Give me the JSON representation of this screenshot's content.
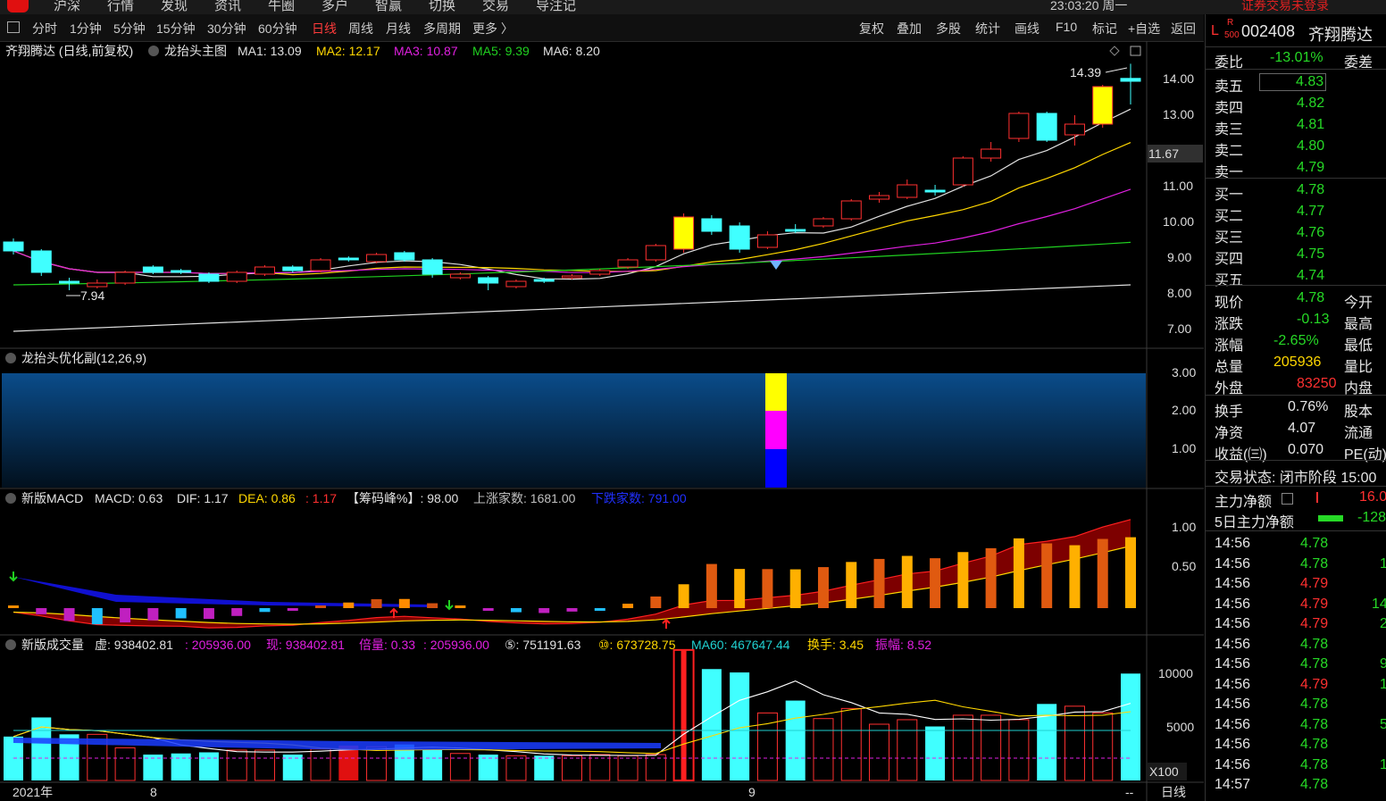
{
  "topbar": {
    "nav": [
      "沪深",
      "行情",
      "发现",
      "资讯",
      "牛圈",
      "多户",
      "智赢",
      "切换",
      "交易",
      "导注记"
    ],
    "clock": "23:03:20 周一",
    "login": "证券交易未登录"
  },
  "toolbar": {
    "periods": [
      {
        "label": "分时"
      },
      {
        "label": "1分钟"
      },
      {
        "label": "5分钟"
      },
      {
        "label": "15分钟"
      },
      {
        "label": "30分钟"
      },
      {
        "label": "60分钟"
      },
      {
        "label": "日线",
        "active": true
      },
      {
        "label": "周线"
      },
      {
        "label": "月线"
      },
      {
        "label": "多周期"
      },
      {
        "label": "更多 〉"
      }
    ],
    "tools": [
      "复权",
      "叠加",
      "多股",
      "统计",
      "画线",
      "F10",
      "标记",
      "+自选",
      "返回"
    ]
  },
  "main_panel": {
    "title": "齐翔腾达 (日线,前复权)",
    "indicator": "龙抬头主图",
    "ma": [
      {
        "label": "MA1: 13.09",
        "color": "#e0e0e0"
      },
      {
        "label": "MA2: 12.17",
        "color": "#ffd700"
      },
      {
        "label": "MA3: 10.87",
        "color": "#e020e0"
      },
      {
        "label": "MA5: 9.39",
        "color": "#20d020"
      },
      {
        "label": "MA6: 8.20",
        "color": "#e0e0e0"
      }
    ],
    "high_label": "14.39",
    "low_label": "7.94",
    "current_price_tag": "11.67",
    "y_ticks": [
      "14.00",
      "13.00",
      "11.00",
      "10.00",
      "9.00",
      "8.00",
      "7.00"
    ]
  },
  "sub1": {
    "title": "龙抬头优化副(12,26,9)",
    "y_ticks": [
      "3.00",
      "2.00",
      "1.00"
    ]
  },
  "macd": {
    "title": "新版MACD",
    "items": [
      {
        "text": "MACD: 0.63",
        "color": "#e0e0e0"
      },
      {
        "text": "DIF: 1.17",
        "color": "#e0e0e0"
      },
      {
        "text": "DEA: 0.86",
        "color": "#ffd700"
      },
      {
        "text": ": 1.17",
        "color": "#ff3030"
      },
      {
        "text": "【筹码峰%】: 98.00",
        "color": "#e0e0e0"
      },
      {
        "text": "上涨家数: 1681.00",
        "color": "#c0c0c0"
      },
      {
        "text": "下跌家数: 791.00",
        "color": "#2030ff"
      }
    ],
    "y_ticks": [
      "1.00",
      "0.50"
    ]
  },
  "volume": {
    "title": "新版成交量",
    "items": [
      {
        "text": "虚: 938402.81",
        "color": "#e0e0e0"
      },
      {
        "text": ": 205936.00",
        "color": "#e020e0"
      },
      {
        "text": "现: 938402.81",
        "color": "#e020e0"
      },
      {
        "text": "倍量: 0.33",
        "color": "#e020e0"
      },
      {
        "text": ": 205936.00",
        "color": "#e020e0"
      },
      {
        "text": "⑤: 751191.63",
        "color": "#e0e0e0"
      },
      {
        "text": "⑩: 673728.75",
        "color": "#ffd700"
      },
      {
        "text": "MA60: 467647.44",
        "color": "#20d0d0"
      },
      {
        "text": "换手: 3.45",
        "color": "#ffd700"
      },
      {
        "text": "振幅: 8.52",
        "color": "#e020e0"
      }
    ],
    "y_ticks": [
      "10000",
      "5000"
    ],
    "unit": "X100"
  },
  "xaxis": {
    "labels": [
      "2021年",
      "8",
      "9"
    ],
    "end_marker": "--",
    "period": "日线"
  },
  "quote": {
    "code": "002408",
    "name": "齐翔腾达",
    "badge_l": "L",
    "badge_r": "R",
    "badge_500": "500",
    "weibi_label": "委比",
    "weibi_value": "-13.01%",
    "weicha_label": "委差",
    "asks": [
      {
        "label": "卖五",
        "price": "4.83"
      },
      {
        "label": "卖四",
        "price": "4.82"
      },
      {
        "label": "卖三",
        "price": "4.81"
      },
      {
        "label": "卖二",
        "price": "4.80"
      },
      {
        "label": "卖一",
        "price": "4.79"
      }
    ],
    "bids": [
      {
        "label": "买一",
        "price": "4.78"
      },
      {
        "label": "买二",
        "price": "4.77"
      },
      {
        "label": "买三",
        "price": "4.76"
      },
      {
        "label": "买四",
        "price": "4.75"
      },
      {
        "label": "买五",
        "price": "4.74"
      }
    ],
    "stats": [
      {
        "label": "现价",
        "value": "4.78",
        "color": "green",
        "right": "今开"
      },
      {
        "label": "涨跌",
        "value": "-0.13",
        "color": "green",
        "right": "最高"
      },
      {
        "label": "涨幅",
        "value": "-2.65%",
        "color": "green",
        "right": "最低"
      },
      {
        "label": "总量",
        "value": "205936",
        "color": "yellow",
        "right": "量比"
      },
      {
        "label": "外盘",
        "value": "83250",
        "color": "red",
        "right": "内盘"
      }
    ],
    "stats2": [
      {
        "label": "换手",
        "value": "0.76%",
        "right": "股本"
      },
      {
        "label": "净资",
        "value": "4.07",
        "right": "流通"
      },
      {
        "label": "收益(㈢)",
        "value": "0.070",
        "right": "PE(动)"
      }
    ],
    "trade_status": "交易状态: 闭市阶段 15:00",
    "main_net_label": "主力净额",
    "main_net_value": "16.0",
    "main5_label": "5日主力净额",
    "main5_value": "-128",
    "ticks": [
      {
        "time": "14:56",
        "price": "4.78",
        "vol": ""
      },
      {
        "time": "14:56",
        "price": "4.78",
        "vol": "1"
      },
      {
        "time": "14:56",
        "price": "4.79",
        "vol": ""
      },
      {
        "time": "14:56",
        "price": "4.79",
        "vol": "14"
      },
      {
        "time": "14:56",
        "price": "4.79",
        "vol": "2"
      },
      {
        "time": "14:56",
        "price": "4.78",
        "vol": ""
      },
      {
        "time": "14:56",
        "price": "4.78",
        "vol": "9"
      },
      {
        "time": "14:56",
        "price": "4.79",
        "vol": "1"
      },
      {
        "time": "14:56",
        "price": "4.78",
        "vol": ""
      },
      {
        "time": "14:56",
        "price": "4.78",
        "vol": "5"
      },
      {
        "time": "14:56",
        "price": "4.78",
        "vol": ""
      },
      {
        "time": "14:56",
        "price": "4.78",
        "vol": "1"
      },
      {
        "time": "14:57",
        "price": "4.78",
        "vol": ""
      }
    ]
  },
  "chart_data": [
    {
      "type": "candlestick",
      "title": "齐翔腾达 (日线,前复权)",
      "ylim": [
        6.5,
        14.8
      ],
      "candles": [
        {
          "o": 9.4,
          "c": 9.15,
          "h": 9.5,
          "l": 9.05
        },
        {
          "o": 9.15,
          "c": 8.55,
          "h": 9.2,
          "l": 8.45
        },
        {
          "o": 8.3,
          "c": 8.25,
          "h": 8.4,
          "l": 8.05
        },
        {
          "o": 8.15,
          "c": 8.25,
          "h": 8.35,
          "l": 8.1
        },
        {
          "o": 8.25,
          "c": 8.55,
          "h": 8.6,
          "l": 8.2
        },
        {
          "o": 8.7,
          "c": 8.55,
          "h": 8.75,
          "l": 8.5
        },
        {
          "o": 8.6,
          "c": 8.55,
          "h": 8.65,
          "l": 8.5
        },
        {
          "o": 8.5,
          "c": 8.3,
          "h": 8.55,
          "l": 8.25
        },
        {
          "o": 8.3,
          "c": 8.55,
          "h": 8.6,
          "l": 8.25
        },
        {
          "o": 8.5,
          "c": 8.7,
          "h": 8.75,
          "l": 8.45
        },
        {
          "o": 8.7,
          "c": 8.6,
          "h": 8.75,
          "l": 8.55
        },
        {
          "o": 8.6,
          "c": 8.9,
          "h": 8.95,
          "l": 8.55
        },
        {
          "o": 8.95,
          "c": 8.9,
          "h": 9.0,
          "l": 8.85
        },
        {
          "o": 8.85,
          "c": 9.05,
          "h": 9.1,
          "l": 8.8
        },
        {
          "o": 9.1,
          "c": 8.9,
          "h": 9.15,
          "l": 8.85
        },
        {
          "o": 8.9,
          "c": 8.5,
          "h": 8.95,
          "l": 8.4
        },
        {
          "o": 8.4,
          "c": 8.5,
          "h": 8.55,
          "l": 8.35
        },
        {
          "o": 8.4,
          "c": 8.25,
          "h": 8.45,
          "l": 8.05
        },
        {
          "o": 8.15,
          "c": 8.3,
          "h": 8.35,
          "l": 8.1
        },
        {
          "o": 8.35,
          "c": 8.3,
          "h": 8.4,
          "l": 8.25
        },
        {
          "o": 8.4,
          "c": 8.45,
          "h": 8.5,
          "l": 8.35
        },
        {
          "o": 8.5,
          "c": 8.6,
          "h": 8.65,
          "l": 8.45
        },
        {
          "o": 8.7,
          "c": 8.9,
          "h": 8.95,
          "l": 8.65
        },
        {
          "o": 8.9,
          "c": 9.3,
          "h": 9.35,
          "l": 8.85
        },
        {
          "o": 9.2,
          "c": 10.1,
          "h": 10.2,
          "l": 9.1
        },
        {
          "o": 10.05,
          "c": 9.7,
          "h": 10.15,
          "l": 9.6
        },
        {
          "o": 9.85,
          "c": 9.2,
          "h": 9.95,
          "l": 9.1
        },
        {
          "o": 9.25,
          "c": 9.6,
          "h": 9.7,
          "l": 9.2
        },
        {
          "o": 9.75,
          "c": 9.7,
          "h": 9.9,
          "l": 9.65
        },
        {
          "o": 9.85,
          "c": 10.05,
          "h": 10.1,
          "l": 9.8
        },
        {
          "o": 10.05,
          "c": 10.55,
          "h": 10.6,
          "l": 10.0
        },
        {
          "o": 10.6,
          "c": 10.7,
          "h": 10.8,
          "l": 10.5
        },
        {
          "o": 10.65,
          "c": 11.0,
          "h": 11.15,
          "l": 10.6
        },
        {
          "o": 10.85,
          "c": 10.8,
          "h": 11.0,
          "l": 10.7
        },
        {
          "o": 11.0,
          "c": 11.75,
          "h": 11.8,
          "l": 10.95
        },
        {
          "o": 11.75,
          "c": 12.0,
          "h": 12.2,
          "l": 11.65
        },
        {
          "o": 12.3,
          "c": 13.0,
          "h": 13.05,
          "l": 12.2
        },
        {
          "o": 13.0,
          "c": 12.25,
          "h": 13.05,
          "l": 12.2
        },
        {
          "o": 12.4,
          "c": 12.7,
          "h": 12.95,
          "l": 12.1
        },
        {
          "o": 12.7,
          "c": 13.75,
          "h": 13.8,
          "l": 12.6
        },
        {
          "o": 13.98,
          "c": 13.9,
          "h": 14.39,
          "l": 13.25
        }
      ]
    }
  ]
}
